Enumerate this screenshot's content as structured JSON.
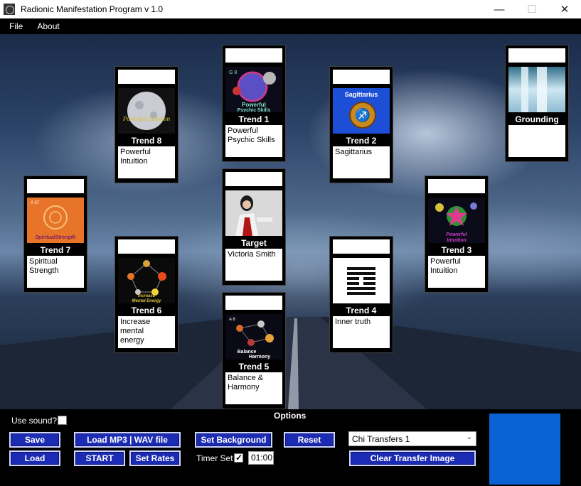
{
  "window": {
    "title": "Radionic Manifestation Program v 1.0",
    "minimize": "—",
    "maximize": "☐",
    "close": "✕"
  },
  "menu": {
    "items": [
      "File",
      "About"
    ]
  },
  "cards": {
    "trend1": {
      "title": "Trend 1",
      "text": "Powerful\nPsychic Skills",
      "image_caption": "Powerful\nPsychic Skills",
      "image_tag": "G 8"
    },
    "trend2": {
      "title": "Trend 2",
      "text": "Sagittarius",
      "image_caption": "Sagittarius"
    },
    "trend3": {
      "title": "Trend 3",
      "text": "Powerful\nIntuition",
      "image_caption": "Powerful\nIntuition"
    },
    "trend4": {
      "title": "Trend 4",
      "text": "Inner truth"
    },
    "trend5": {
      "title": "Trend 5",
      "text": "Balance &\nHarmony",
      "image_caption": "Balance\nHarmony",
      "image_tag": "A 8"
    },
    "trend6": {
      "title": "Trend 6",
      "text": "Increase mental\nenergy",
      "image_caption": "Increase\nMental Energy"
    },
    "trend7": {
      "title": "Trend 7",
      "text": "Spiritual\nStrength",
      "image_caption": "SpiritualStrength",
      "image_tag": "A 37"
    },
    "trend8": {
      "title": "Trend 8",
      "text": "Powerful\nIntuition",
      "image_caption": "Powerful\nIntuition"
    },
    "target": {
      "title": "Target",
      "text": "Victoria Smith"
    },
    "grounding": {
      "title": "Grounding",
      "text": ""
    }
  },
  "options": {
    "title": "Options",
    "use_sound_label": "Use sound?",
    "use_sound_checked": false,
    "save": "Save",
    "load": "Load",
    "load_media": "Load MP3 | WAV file",
    "start": "START",
    "set_rates": "Set Rates",
    "set_background": "Set Background",
    "reset": "Reset",
    "timer_label": "Timer Set",
    "timer_checked": true,
    "timer_value": "01:00",
    "chi_select": "Chi Transfers 1",
    "clear_transfer": "Clear Transfer Image"
  },
  "colors": {
    "button_bg": "#1b2bb3",
    "transfer_image": "#0a62d2",
    "panel_bg": "#000000"
  }
}
